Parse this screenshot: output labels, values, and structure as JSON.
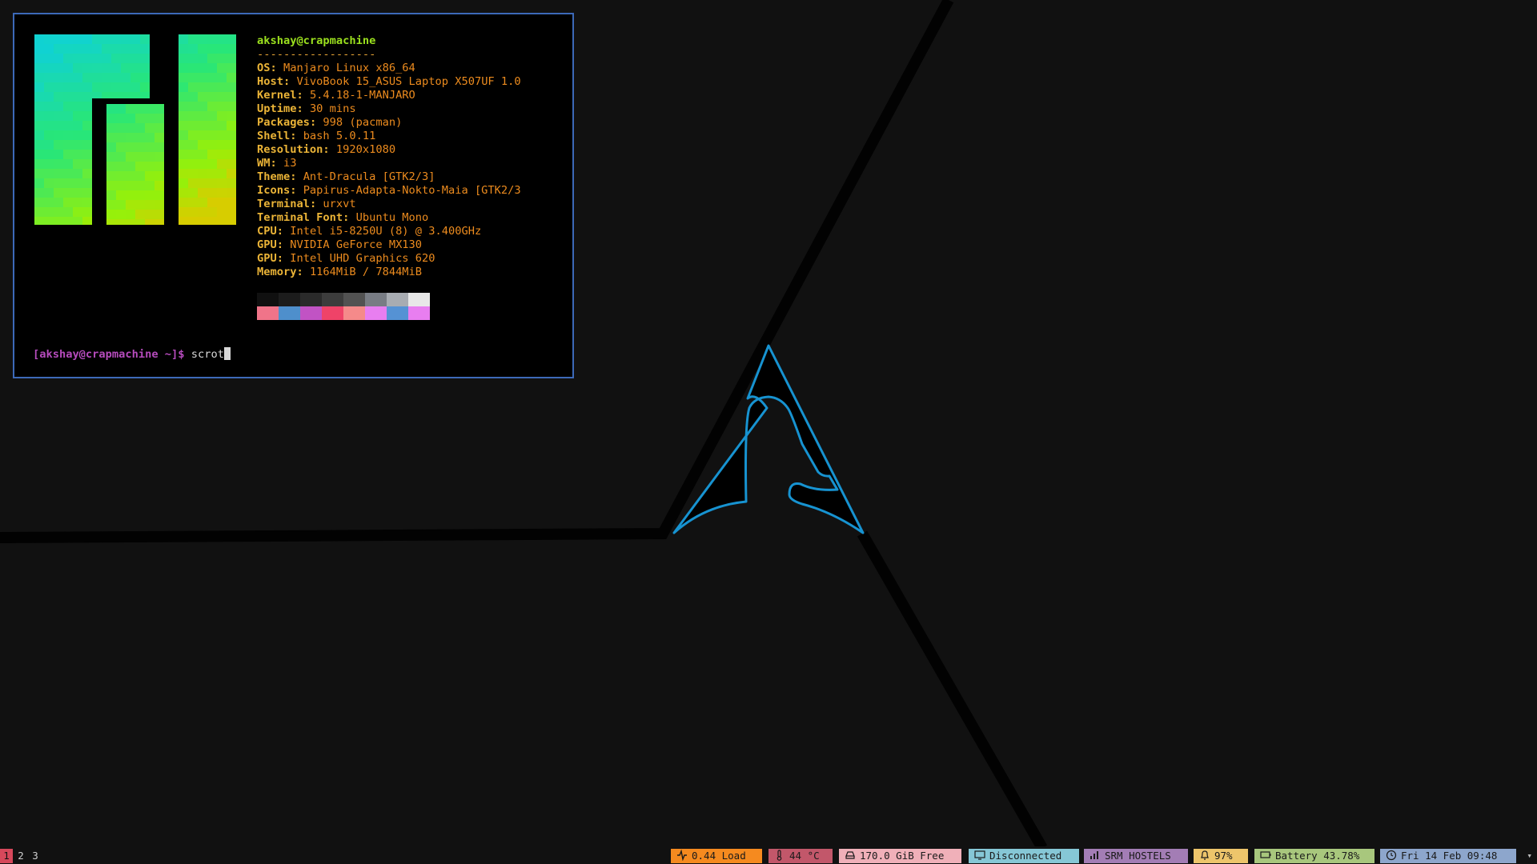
{
  "terminal": {
    "user_host": "akshay@crapmachine",
    "separator": "------------------",
    "info": [
      {
        "key": "OS",
        "value": "Manjaro Linux x86_64"
      },
      {
        "key": "Host",
        "value": "VivoBook 15_ASUS Laptop X507UF 1.0"
      },
      {
        "key": "Kernel",
        "value": "5.4.18-1-MANJARO"
      },
      {
        "key": "Uptime",
        "value": "30 mins"
      },
      {
        "key": "Packages",
        "value": "998 (pacman)"
      },
      {
        "key": "Shell",
        "value": "bash 5.0.11"
      },
      {
        "key": "Resolution",
        "value": "1920x1080"
      },
      {
        "key": "WM",
        "value": "i3"
      },
      {
        "key": "Theme",
        "value": "Ant-Dracula [GTK2/3]"
      },
      {
        "key": "Icons",
        "value": "Papirus-Adapta-Nokto-Maia [GTK2/3"
      },
      {
        "key": "Terminal",
        "value": "urxvt"
      },
      {
        "key": "Terminal Font",
        "value": "Ubuntu Mono"
      },
      {
        "key": "CPU",
        "value": "Intel i5-8250U (8) @ 3.400GHz"
      },
      {
        "key": "GPU",
        "value": "NVIDIA GeForce MX130"
      },
      {
        "key": "GPU",
        "value": "Intel UHD Graphics 620"
      },
      {
        "key": "Memory",
        "value": "1164MiB / 7844MiB"
      }
    ],
    "palette_row1": [
      "#101010",
      "#1c1c1c",
      "#2a2a2a",
      "#3c3c3c",
      "#525252",
      "#787c84",
      "#a8acb2",
      "#e8e8e8"
    ],
    "palette_row2": [
      "#f07489",
      "#4e8fcc",
      "#c153c4",
      "#ef4368",
      "#f58a8a",
      "#e87ef0",
      "#5592d4",
      "#e87ef0"
    ],
    "prompt": "[akshay@crapmachine ~]$",
    "command": "scrot"
  },
  "colors": {
    "accent_border": "#3c69b8",
    "arch_logo": "#1793d1"
  },
  "bar": {
    "workspaces": [
      "1",
      "2",
      "3"
    ],
    "active_workspace": "1",
    "blocks": [
      {
        "name": "load",
        "icon": "activity-icon",
        "text": "0.44 Load",
        "color": "#f58a1f"
      },
      {
        "name": "temperature",
        "icon": "thermometer-icon",
        "text": "44 °C",
        "color": "#c2576a"
      },
      {
        "name": "disk",
        "icon": "disk-icon",
        "text": "170.0 GiB Free",
        "color": "#f0b0b9"
      },
      {
        "name": "ethernet",
        "icon": "monitor-icon",
        "text": "Disconnected",
        "color": "#86c7d6"
      },
      {
        "name": "wifi",
        "icon": "signal-icon",
        "text": "SRM HOSTELS",
        "color": "#a37db5"
      },
      {
        "name": "volume",
        "icon": "bell-icon",
        "text": "97%",
        "color": "#edc56b"
      },
      {
        "name": "battery",
        "icon": "battery-icon",
        "text": "Battery 43.78%",
        "color": "#a8c77d"
      },
      {
        "name": "clock",
        "icon": "clock-icon",
        "text": "Fri 14 Feb 09:48",
        "color": "#8da6cc"
      }
    ],
    "tray_icon": "chevron-down-icon"
  }
}
